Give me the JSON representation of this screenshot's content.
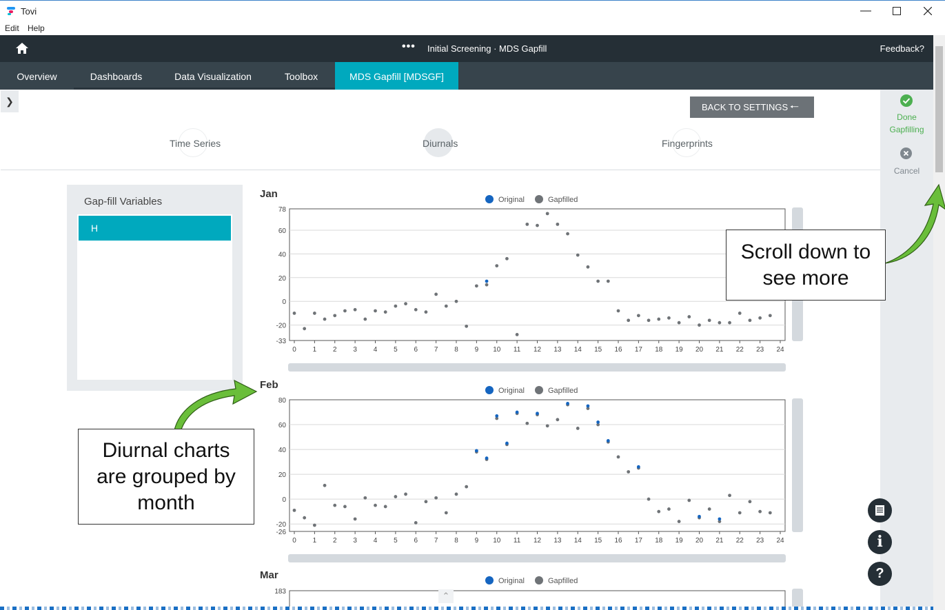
{
  "window": {
    "title": "Tovi"
  },
  "menu": [
    "Edit",
    "Help"
  ],
  "header": {
    "title": "Initial Screening · MDS Gapfill",
    "dots": "•••",
    "feedback": "Feedback?"
  },
  "tabs": [
    "Overview",
    "Dashboards",
    "Data Visualization",
    "Toolbox",
    "MDS Gapfill [MDSGF]"
  ],
  "actions": {
    "back_to_settings": "BACK TO SETTINGS",
    "done_line1": "Done",
    "done_line2": "Gapfilling",
    "cancel": "Cancel"
  },
  "steps": [
    "Time Series",
    "Diurnals",
    "Fingerprints"
  ],
  "variables": {
    "title": "Gap-fill Variables",
    "items": [
      "H"
    ]
  },
  "legend": {
    "original": "Original",
    "gapfilled": "Gapfilled"
  },
  "colors": {
    "original": "#1565c0",
    "gapfilled": "#6f7377",
    "accent": "#00a9be",
    "done": "#4caf50",
    "arrow": "#6abe3a"
  },
  "callouts": {
    "scroll": [
      "Scroll down to",
      "see more"
    ],
    "diurnal": [
      "Diurnal charts",
      "are grouped by",
      "month"
    ]
  },
  "chart_data": [
    {
      "type": "scatter",
      "title": "Jan",
      "x_ticks": [
        0,
        1,
        2,
        3,
        4,
        5,
        6,
        7,
        8,
        9,
        10,
        11,
        12,
        13,
        14,
        15,
        16,
        17,
        18,
        19,
        20,
        21,
        22,
        23,
        24
      ],
      "ylim": [
        -33,
        78
      ],
      "y_ticks": [
        -33,
        -20,
        0,
        20,
        40,
        60,
        78
      ],
      "series": [
        {
          "name": "Original",
          "x": [
            9.5
          ],
          "y": [
            17
          ]
        },
        {
          "name": "Gapfilled",
          "x": [
            0,
            0.5,
            1,
            1.5,
            2,
            2.5,
            3,
            3.5,
            4,
            4.5,
            5,
            5.5,
            6,
            6.5,
            7,
            7.5,
            8,
            8.5,
            9,
            9.5,
            10,
            10.5,
            11,
            11.5,
            12,
            12.5,
            13,
            13.5,
            14,
            14.5,
            15,
            15.5,
            16,
            16.5,
            17,
            17.5,
            18,
            18.5,
            19,
            19.5,
            20,
            20.5,
            21,
            21.5,
            22,
            22.5,
            23,
            23.5
          ],
          "y": [
            -10,
            -23,
            -10,
            -15,
            -12,
            -8,
            -7,
            -15,
            -8,
            -9,
            -4,
            -2,
            -7,
            -9,
            6,
            -4,
            0,
            -21,
            13,
            14,
            30,
            36,
            -28,
            65,
            64,
            74,
            65,
            57,
            39,
            29,
            17,
            17,
            -8,
            -16,
            -12,
            -16,
            -15,
            -14,
            -18,
            -13,
            -20,
            -16,
            -18,
            -18,
            -10,
            -16,
            -14,
            -12
          ]
        }
      ]
    },
    {
      "type": "scatter",
      "title": "Feb",
      "x_ticks": [
        0,
        1,
        2,
        3,
        4,
        5,
        6,
        7,
        8,
        9,
        10,
        11,
        12,
        13,
        14,
        15,
        16,
        17,
        18,
        19,
        20,
        21,
        22,
        23,
        24
      ],
      "ylim": [
        -26,
        80
      ],
      "y_ticks": [
        -26,
        -20,
        0,
        20,
        40,
        60,
        80
      ],
      "series": [
        {
          "name": "Original",
          "x": [
            9,
            9.5,
            10,
            10.5,
            11,
            12,
            13.5,
            14.5,
            15,
            15.5,
            17,
            20,
            21
          ],
          "y": [
            39,
            33,
            67,
            45,
            70,
            69,
            77,
            75,
            62,
            47,
            26,
            -14,
            -16
          ]
        },
        {
          "name": "Gapfilled",
          "x": [
            0,
            0.5,
            1,
            1.5,
            2,
            2.5,
            3,
            3.5,
            4,
            4.5,
            5,
            5.5,
            6,
            6.5,
            7,
            7.5,
            8,
            8.5,
            9,
            9.5,
            10,
            10.5,
            11,
            11.5,
            12,
            12.5,
            13,
            13.5,
            14,
            14.5,
            15,
            15.5,
            16,
            16.5,
            17,
            17.5,
            18,
            18.5,
            19,
            19.5,
            20,
            20.5,
            21,
            21.5,
            22,
            22.5,
            23,
            23.5
          ],
          "y": [
            -9,
            -15,
            -21,
            11,
            -5,
            -6,
            -16,
            1,
            -5,
            -6,
            2,
            4,
            -19,
            -2,
            1,
            -11,
            4,
            10,
            38,
            32,
            65,
            44,
            69,
            61,
            68,
            59,
            64,
            76,
            57,
            73,
            60,
            46,
            34,
            22,
            25,
            0,
            -10,
            -8,
            -18,
            -1,
            -15,
            -8,
            -18,
            3,
            -11,
            -2,
            -10,
            -11
          ]
        }
      ]
    },
    {
      "type": "scatter",
      "title": "Mar",
      "x_ticks": [],
      "ylim": [
        null,
        183
      ],
      "y_ticks": [
        183
      ],
      "series": [
        {
          "name": "Original",
          "x": [],
          "y": []
        },
        {
          "name": "Gapfilled",
          "x": [],
          "y": []
        }
      ]
    }
  ]
}
